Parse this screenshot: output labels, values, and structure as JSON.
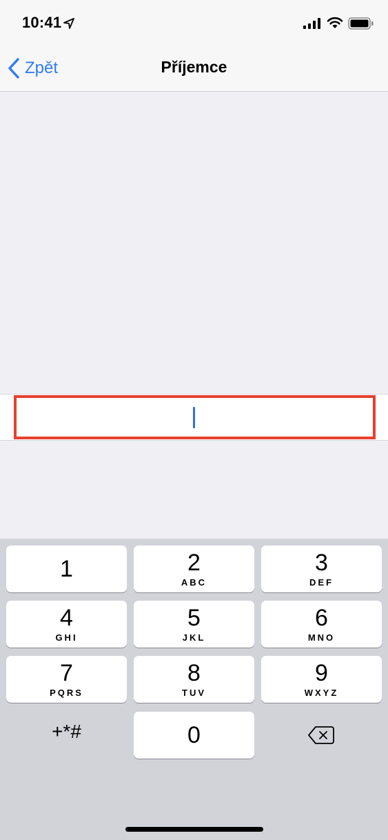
{
  "status_bar": {
    "time": "10:41",
    "icons": [
      "location-arrow-icon",
      "cellular-signal-icon",
      "wifi-icon",
      "battery-icon"
    ]
  },
  "nav": {
    "back_label": "Zpět",
    "title": "Příjemce"
  },
  "recipient_input": {
    "value": "",
    "placeholder": ""
  },
  "keypad": {
    "keys": [
      {
        "digit": "1",
        "letters": ""
      },
      {
        "digit": "2",
        "letters": "ABC"
      },
      {
        "digit": "3",
        "letters": "DEF"
      },
      {
        "digit": "4",
        "letters": "GHI"
      },
      {
        "digit": "5",
        "letters": "JKL"
      },
      {
        "digit": "6",
        "letters": "MNO"
      },
      {
        "digit": "7",
        "letters": "PQRS"
      },
      {
        "digit": "8",
        "letters": "TUV"
      },
      {
        "digit": "9",
        "letters": "WXYZ"
      },
      {
        "digit": "0",
        "letters": ""
      }
    ],
    "symbols_label": "+*#",
    "delete_icon": "delete-backspace-icon"
  },
  "colors": {
    "accent": "#2f7cf6",
    "highlight": "#e8402f",
    "background": "#efeff4",
    "keyboard_bg": "#d1d3d9"
  }
}
